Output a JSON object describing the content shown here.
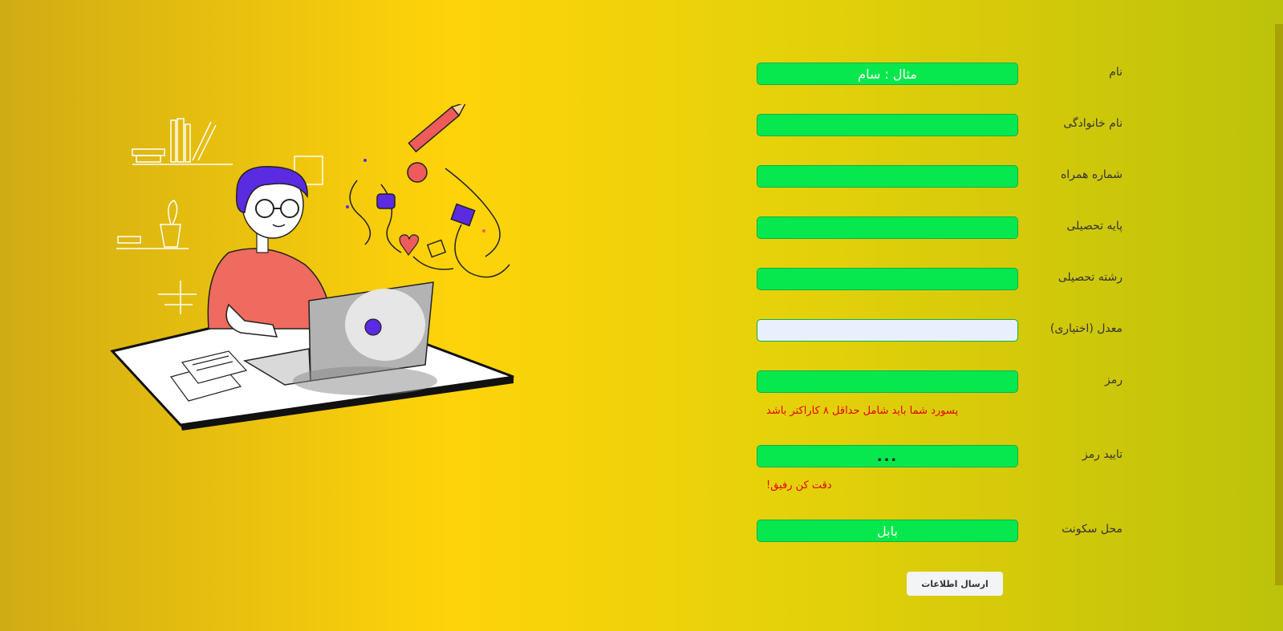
{
  "form": {
    "fields": [
      {
        "label": "نام",
        "value": "",
        "placeholder": "مثال : سام"
      },
      {
        "label": "نام خانوادگی",
        "value": "",
        "placeholder": ""
      },
      {
        "label": "شماره همراه",
        "value": "",
        "placeholder": ""
      },
      {
        "label": "پایه تحصیلی",
        "value": "",
        "placeholder": ""
      },
      {
        "label": "رشته تحصیلی",
        "value": "",
        "placeholder": ""
      },
      {
        "label": "معدل (اختیاری)",
        "value": "",
        "placeholder": ""
      },
      {
        "label": "رمز",
        "value": "",
        "placeholder": ""
      },
      {
        "label": "تایید رمز",
        "value": "...",
        "placeholder": ""
      },
      {
        "label": "محل سکونت",
        "value": "بابل",
        "placeholder": ""
      }
    ],
    "password_error": "پسورد شما باید شامل حداقل ۸ کاراکتر باشد",
    "confirm_error": "دقت کن رفیق!",
    "submit_label": "ارسال اطلاعات"
  },
  "illustration": {
    "icon": "student-at-laptop-illustration"
  }
}
